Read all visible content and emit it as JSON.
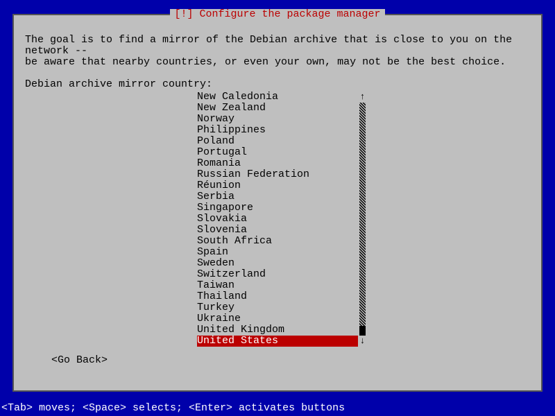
{
  "dialog": {
    "title": "[!] Configure the package manager",
    "instruction": "The goal is to find a mirror of the Debian archive that is close to you on the network --\nbe aware that nearby countries, or even your own, may not be the best choice.",
    "prompt": "Debian archive mirror country:",
    "go_back": "<Go Back>"
  },
  "countries": [
    "New Caledonia",
    "New Zealand",
    "Norway",
    "Philippines",
    "Poland",
    "Portugal",
    "Romania",
    "Russian Federation",
    "Réunion",
    "Serbia",
    "Singapore",
    "Slovakia",
    "Slovenia",
    "South Africa",
    "Spain",
    "Sweden",
    "Switzerland",
    "Taiwan",
    "Thailand",
    "Turkey",
    "Ukraine",
    "United Kingdom",
    "United States"
  ],
  "selected_index": 22,
  "scroll": {
    "up_arrow": "↑",
    "down_arrow": "↓"
  },
  "footer": "<Tab> moves; <Space> selects; <Enter> activates buttons"
}
